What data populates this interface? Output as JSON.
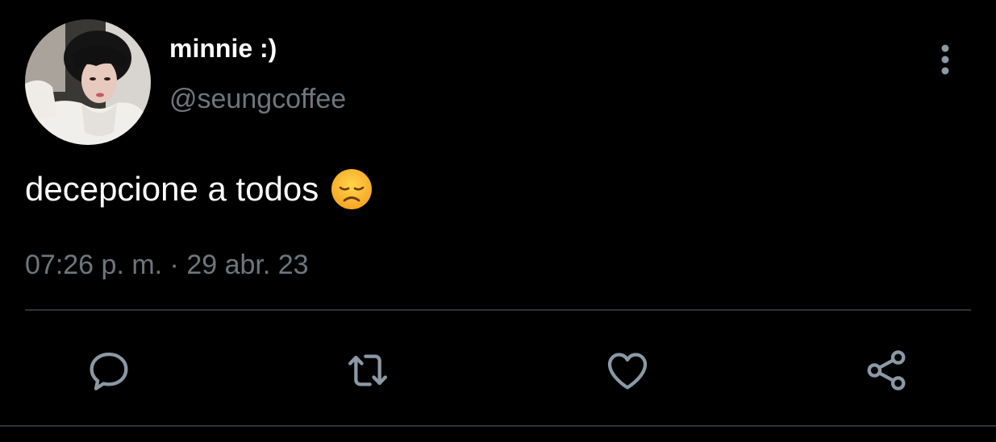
{
  "tweet": {
    "display_name": "minnie :)",
    "handle": "@seungcoffee",
    "text": "decepcione a todos",
    "emoji": "disappointed-face",
    "timestamp": "07:26 p. m. · 29 abr. 23"
  },
  "actions": [
    {
      "name": "reply",
      "icon": "reply-bubble-icon"
    },
    {
      "name": "retweet",
      "icon": "retweet-icon"
    },
    {
      "name": "like",
      "icon": "heart-icon"
    },
    {
      "name": "share",
      "icon": "share-icon"
    }
  ],
  "colors": {
    "background": "#000000",
    "primary_text": "#ffffff",
    "secondary_text": "#6e767d",
    "divider": "#2f3336",
    "icon": "#8b98a5"
  }
}
